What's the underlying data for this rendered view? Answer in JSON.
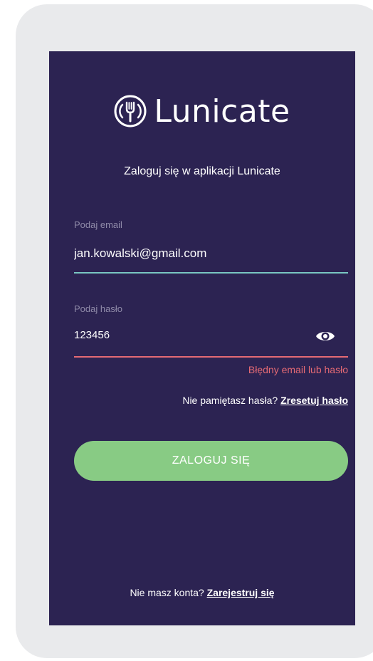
{
  "brand": {
    "name": "Lunicate",
    "logo_icon": "fork-in-circle-icon"
  },
  "subtitle": "Zaloguj się w aplikacji Lunicate",
  "email": {
    "label": "Podaj email",
    "value": "jan.kowalski@gmail.com"
  },
  "password": {
    "label": "Podaj hasło",
    "value": "123456",
    "toggle_icon": "eye-icon"
  },
  "error": "Błędny email lub hasło",
  "forgot": {
    "text": "Nie pamiętasz hasła?",
    "link": "Zresetuj hasło"
  },
  "login_button": "ZALOGUJ SIĘ",
  "register": {
    "text": "Nie masz konta?",
    "link": "Zarejestruj się"
  },
  "colors": {
    "background": "#2c2352",
    "device_frame": "#e9eaec",
    "button": "#88cb84",
    "email_underline": "#79c7c2",
    "error": "#e56a74",
    "label": "#8f8aa8"
  }
}
